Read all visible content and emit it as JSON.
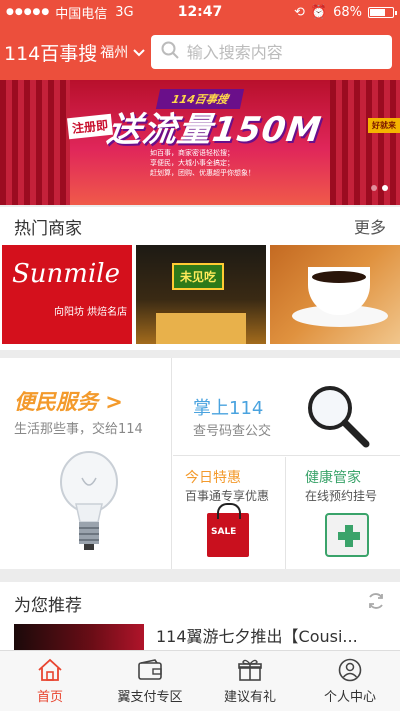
{
  "status": {
    "signal": "●●●●●",
    "carrier": "中国电信",
    "network": "3G",
    "time": "12:47",
    "battery_text": "68%",
    "battery_level": 0.68
  },
  "header": {
    "brand": "114百事搜",
    "city": "福州",
    "search_placeholder": "输入搜索内容"
  },
  "banner": {
    "ribbon": "114百事搜",
    "tag": "注册即",
    "headline": "送流量150M",
    "sub_lines": [
      "如百事，商家密语轻松搜；",
      "享便民，大城小事全搞定；",
      "赶划算，团购、优惠超乎你想象！"
    ],
    "badge": "好就来",
    "slides": 2,
    "active_slide": 1
  },
  "hot": {
    "title": "热门商家",
    "more": "更多",
    "shops": [
      {
        "name": "Sunmile",
        "sub": "向阳坊 烘焙名店"
      },
      {
        "name": "未见吃",
        "sub": ""
      },
      {
        "name": "",
        "sub": ""
      }
    ]
  },
  "services": {
    "main": {
      "title": "便民服务 >",
      "subtitle": "生活那些事，交给114"
    },
    "palm": {
      "title": "掌上114",
      "subtitle": "查号码查公交"
    },
    "deals": {
      "title": "今日特惠",
      "subtitle": "百事通专享优惠",
      "bag_text": "SALE"
    },
    "health": {
      "title": "健康管家",
      "subtitle": "在线预约挂号"
    }
  },
  "recommend": {
    "title": "为您推荐",
    "item_text": "114翼游七夕推出【Cousi..."
  },
  "tabs": [
    {
      "label": "首页",
      "icon": "home-icon"
    },
    {
      "label": "翼支付专区",
      "icon": "wallet-icon"
    },
    {
      "label": "建议有礼",
      "icon": "gift-icon"
    },
    {
      "label": "个人中心",
      "icon": "user-icon"
    }
  ],
  "colors": {
    "primary": "#ec4f3c",
    "orange": "#f39a2c",
    "blue": "#4aa3df",
    "green": "#3aa36a",
    "active_tab": "#e8442f"
  }
}
